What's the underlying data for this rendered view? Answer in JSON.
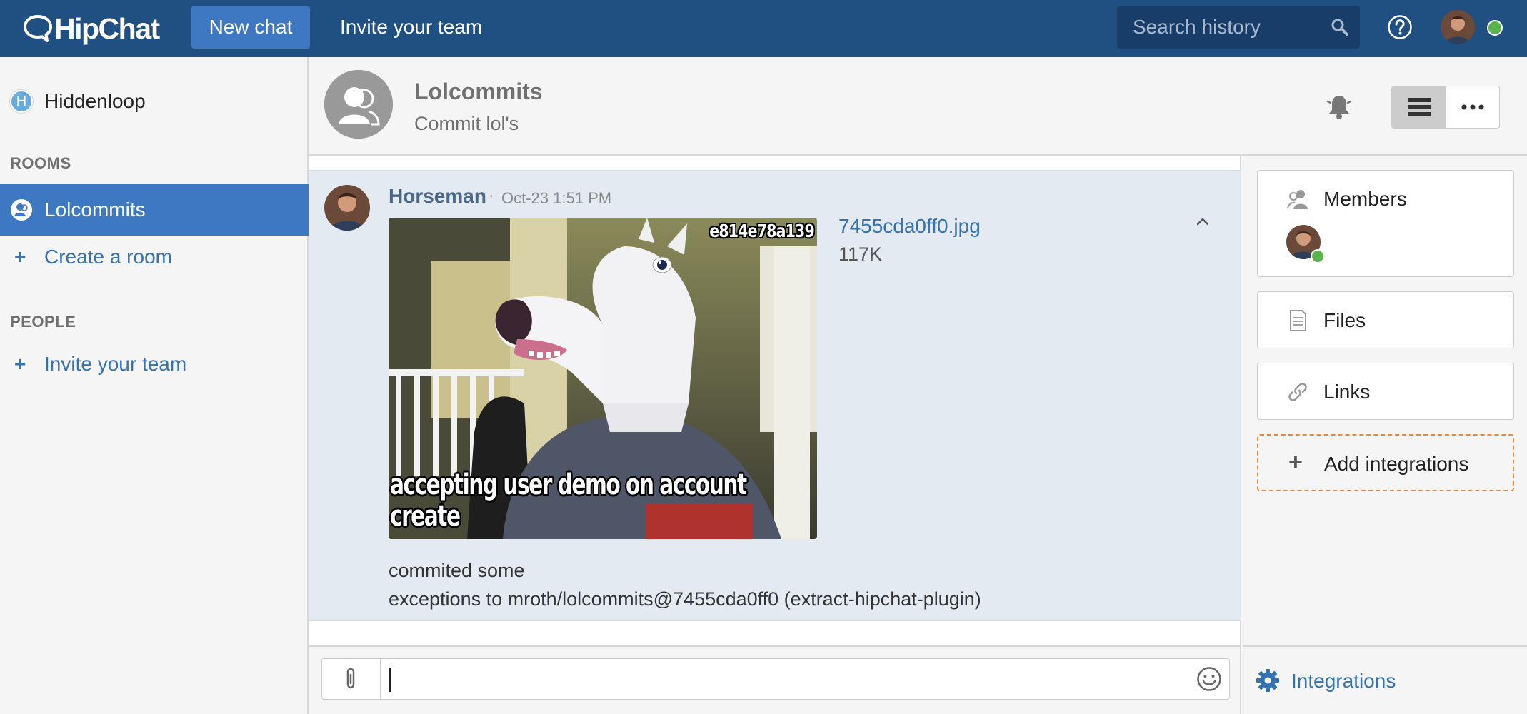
{
  "topbar": {
    "logo_text": "HipChat",
    "new_chat_label": "New chat",
    "invite_label": "Invite your team",
    "search_placeholder": "Search history",
    "status_color": "#59b24b"
  },
  "sidebar": {
    "team_initial": "H",
    "team_name": "Hiddenloop",
    "rooms_heading": "ROOMS",
    "active_room": "Lolcommits",
    "create_room_label": "Create a room",
    "people_heading": "PEOPLE",
    "invite_label": "Invite your team"
  },
  "room": {
    "title": "Lolcommits",
    "topic": "Commit lol's"
  },
  "message": {
    "sender": "Horseman",
    "separator": "·",
    "time": "Oct-23 1:51 PM",
    "image_caption_top": "e814e78a139",
    "image_caption_bottom_1": "accepting user demo on account",
    "image_caption_bottom_2": "create",
    "file_name": "7455cda0ff0.jpg",
    "file_size": "117K",
    "text_line1": "commited some",
    "text_line2": "exceptions to mroth/lolcommits@7455cda0ff0 (extract-hipchat-plugin)"
  },
  "composer": {
    "value": ""
  },
  "right_panel": {
    "members_label": "Members",
    "files_label": "Files",
    "links_label": "Links",
    "add_integrations_label": "Add integrations",
    "integrations_label": "Integrations"
  },
  "colors": {
    "topbar": "#205081",
    "accent": "#3e78c2",
    "link": "#3572b0",
    "message_bg": "#e3eaf2",
    "add_border": "#e9883a"
  },
  "icons": [
    "chat-bubble-icon",
    "search-icon",
    "help-icon",
    "room-icon",
    "bell-icon",
    "list-view-icon",
    "more-icon",
    "collapse-icon",
    "paperclip-icon",
    "smiley-icon",
    "members-icon",
    "file-icon",
    "link-icon",
    "plus-icon",
    "gear-icon"
  ]
}
